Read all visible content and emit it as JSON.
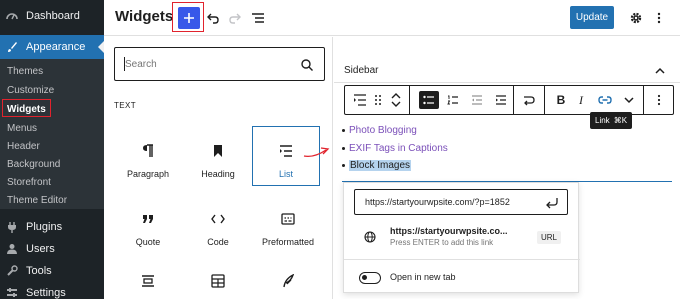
{
  "admin_menu": {
    "dashboard": "Dashboard",
    "appearance": "Appearance",
    "submenu": [
      "Themes",
      "Customize",
      "Widgets",
      "Menus",
      "Header",
      "Background",
      "Storefront",
      "Theme Editor"
    ],
    "plugins": "Plugins",
    "users": "Users",
    "tools": "Tools",
    "settings": "Settings",
    "active_color": "#2271b1",
    "highlight_color": "#e1232d"
  },
  "header": {
    "title": "Widgets",
    "update_label": "Update",
    "add_button_color": "#3858e9",
    "icons": [
      "plus-icon",
      "undo-icon",
      "redo-icon",
      "list-view-icon",
      "gear-icon",
      "more-vertical-icon"
    ]
  },
  "inserter": {
    "search_placeholder": "Search",
    "category": "TEXT",
    "blocks": [
      {
        "label": "Paragraph",
        "icon": "paragraph-icon"
      },
      {
        "label": "Heading",
        "icon": "heading-icon"
      },
      {
        "label": "List",
        "icon": "list-icon",
        "selected": true
      },
      {
        "label": "Quote",
        "icon": "quote-icon"
      },
      {
        "label": "Code",
        "icon": "code-icon"
      },
      {
        "label": "Preformatted",
        "icon": "preformatted-icon"
      },
      {
        "label": "",
        "icon": "pullquote-icon"
      },
      {
        "label": "",
        "icon": "table-icon"
      },
      {
        "label": "",
        "icon": "verse-icon"
      }
    ]
  },
  "editor": {
    "area_label": "Sidebar",
    "list_items": [
      "Photo Blogging",
      "EXIF Tags in Captions",
      "Block Images"
    ],
    "link_color": "#7b50b9",
    "tooltip": {
      "label": "Link",
      "shortcut": "⌘K"
    }
  },
  "link_popover": {
    "url": "https://startyourwpsite.com/?p=1852",
    "suggestion_title": "https://startyourwpsite.co...",
    "suggestion_hint": "Press ENTER to add this link",
    "suggestion_type": "URL",
    "new_tab_label": "Open in new tab",
    "new_tab_enabled": false
  }
}
